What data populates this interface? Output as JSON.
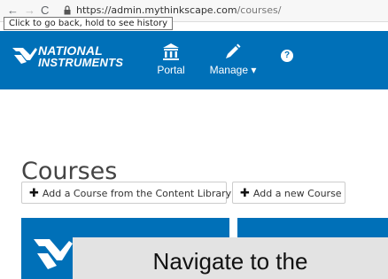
{
  "browser": {
    "back_glyph": "←",
    "forward_glyph": "→",
    "reload_glyph": "C",
    "url_host": "https://admin.mythinkscape.com",
    "url_path": "/courses/",
    "tooltip": "Click to go back, hold to see history"
  },
  "header": {
    "logo_line1": "NATIONAL",
    "logo_line2": "INSTRUMENTS",
    "nav": {
      "portal": "Portal",
      "manage": "Manage"
    },
    "help_glyph": "?",
    "color": "#0070b8"
  },
  "main": {
    "title": "Courses",
    "buttons": {
      "add_from_library": "Add a Course from the Content Library",
      "add_new": "Add a new Course"
    }
  },
  "overlay": {
    "text": "Navigate to the"
  },
  "icons": [
    "back-icon",
    "forward-icon",
    "reload-icon",
    "lock-icon",
    "portal-icon",
    "manage-icon",
    "help-icon",
    "plus-icon"
  ]
}
